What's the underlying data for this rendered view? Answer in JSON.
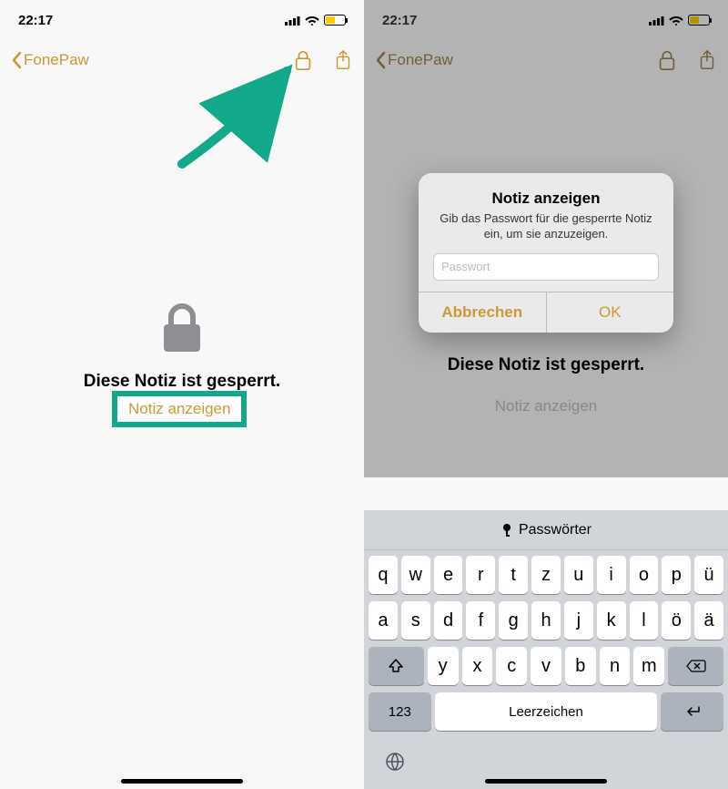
{
  "status": {
    "time": "22:17"
  },
  "nav": {
    "back_label": "FonePaw"
  },
  "locked": {
    "title": "Diese Notiz ist gesperrt.",
    "view_button": "Notiz anzeigen"
  },
  "alert": {
    "title": "Notiz anzeigen",
    "message": "Gib das Passwort für die gesperrte Notiz ein, um sie anzuzeigen.",
    "placeholder": "Passwort",
    "cancel": "Abbrechen",
    "ok": "OK"
  },
  "keyboard": {
    "suggestion": "Passwörter",
    "row1": [
      "q",
      "w",
      "e",
      "r",
      "t",
      "z",
      "u",
      "i",
      "o",
      "p",
      "ü"
    ],
    "row2": [
      "a",
      "s",
      "d",
      "f",
      "g",
      "h",
      "j",
      "k",
      "l",
      "ö",
      "ä"
    ],
    "row3": [
      "y",
      "x",
      "c",
      "v",
      "b",
      "n",
      "m"
    ],
    "numkey": "123",
    "space": "Leerzeichen"
  },
  "battery": {
    "level_percent": 45
  }
}
